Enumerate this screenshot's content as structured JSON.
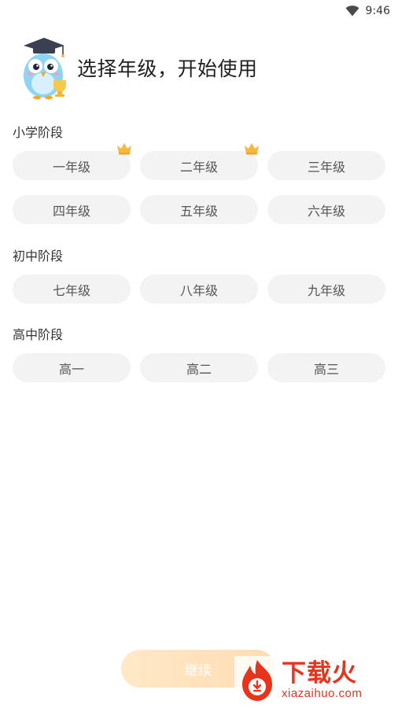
{
  "status_bar": {
    "time": "9:46",
    "wifi_icon": "wifi-icon"
  },
  "header": {
    "title": "选择年级，开始使用",
    "mascot_icon": "owl-mascot-icon"
  },
  "sections": [
    {
      "title": "小学阶段",
      "grades": [
        {
          "label": "一年级",
          "crown": true
        },
        {
          "label": "二年级",
          "crown": true
        },
        {
          "label": "三年级",
          "crown": false
        },
        {
          "label": "四年级",
          "crown": false
        },
        {
          "label": "五年级",
          "crown": false
        },
        {
          "label": "六年级",
          "crown": false
        }
      ]
    },
    {
      "title": "初中阶段",
      "grades": [
        {
          "label": "七年级",
          "crown": false
        },
        {
          "label": "八年级",
          "crown": false
        },
        {
          "label": "九年级",
          "crown": false
        }
      ]
    },
    {
      "title": "高中阶段",
      "grades": [
        {
          "label": "高一",
          "crown": false
        },
        {
          "label": "高二",
          "crown": false
        },
        {
          "label": "高三",
          "crown": false
        }
      ]
    }
  ],
  "footer": {
    "continue_label": "继续"
  },
  "watermark": {
    "text_cn": "下载火",
    "text_en": "xiazaihuo.com"
  },
  "colors": {
    "chip_bg": "#f3f3f3",
    "chip_text": "#555555",
    "button_gradient_start": "#ffe9c8",
    "button_gradient_end": "#ffdcb2",
    "crown": "#f5b840",
    "watermark": "#e8331d"
  }
}
